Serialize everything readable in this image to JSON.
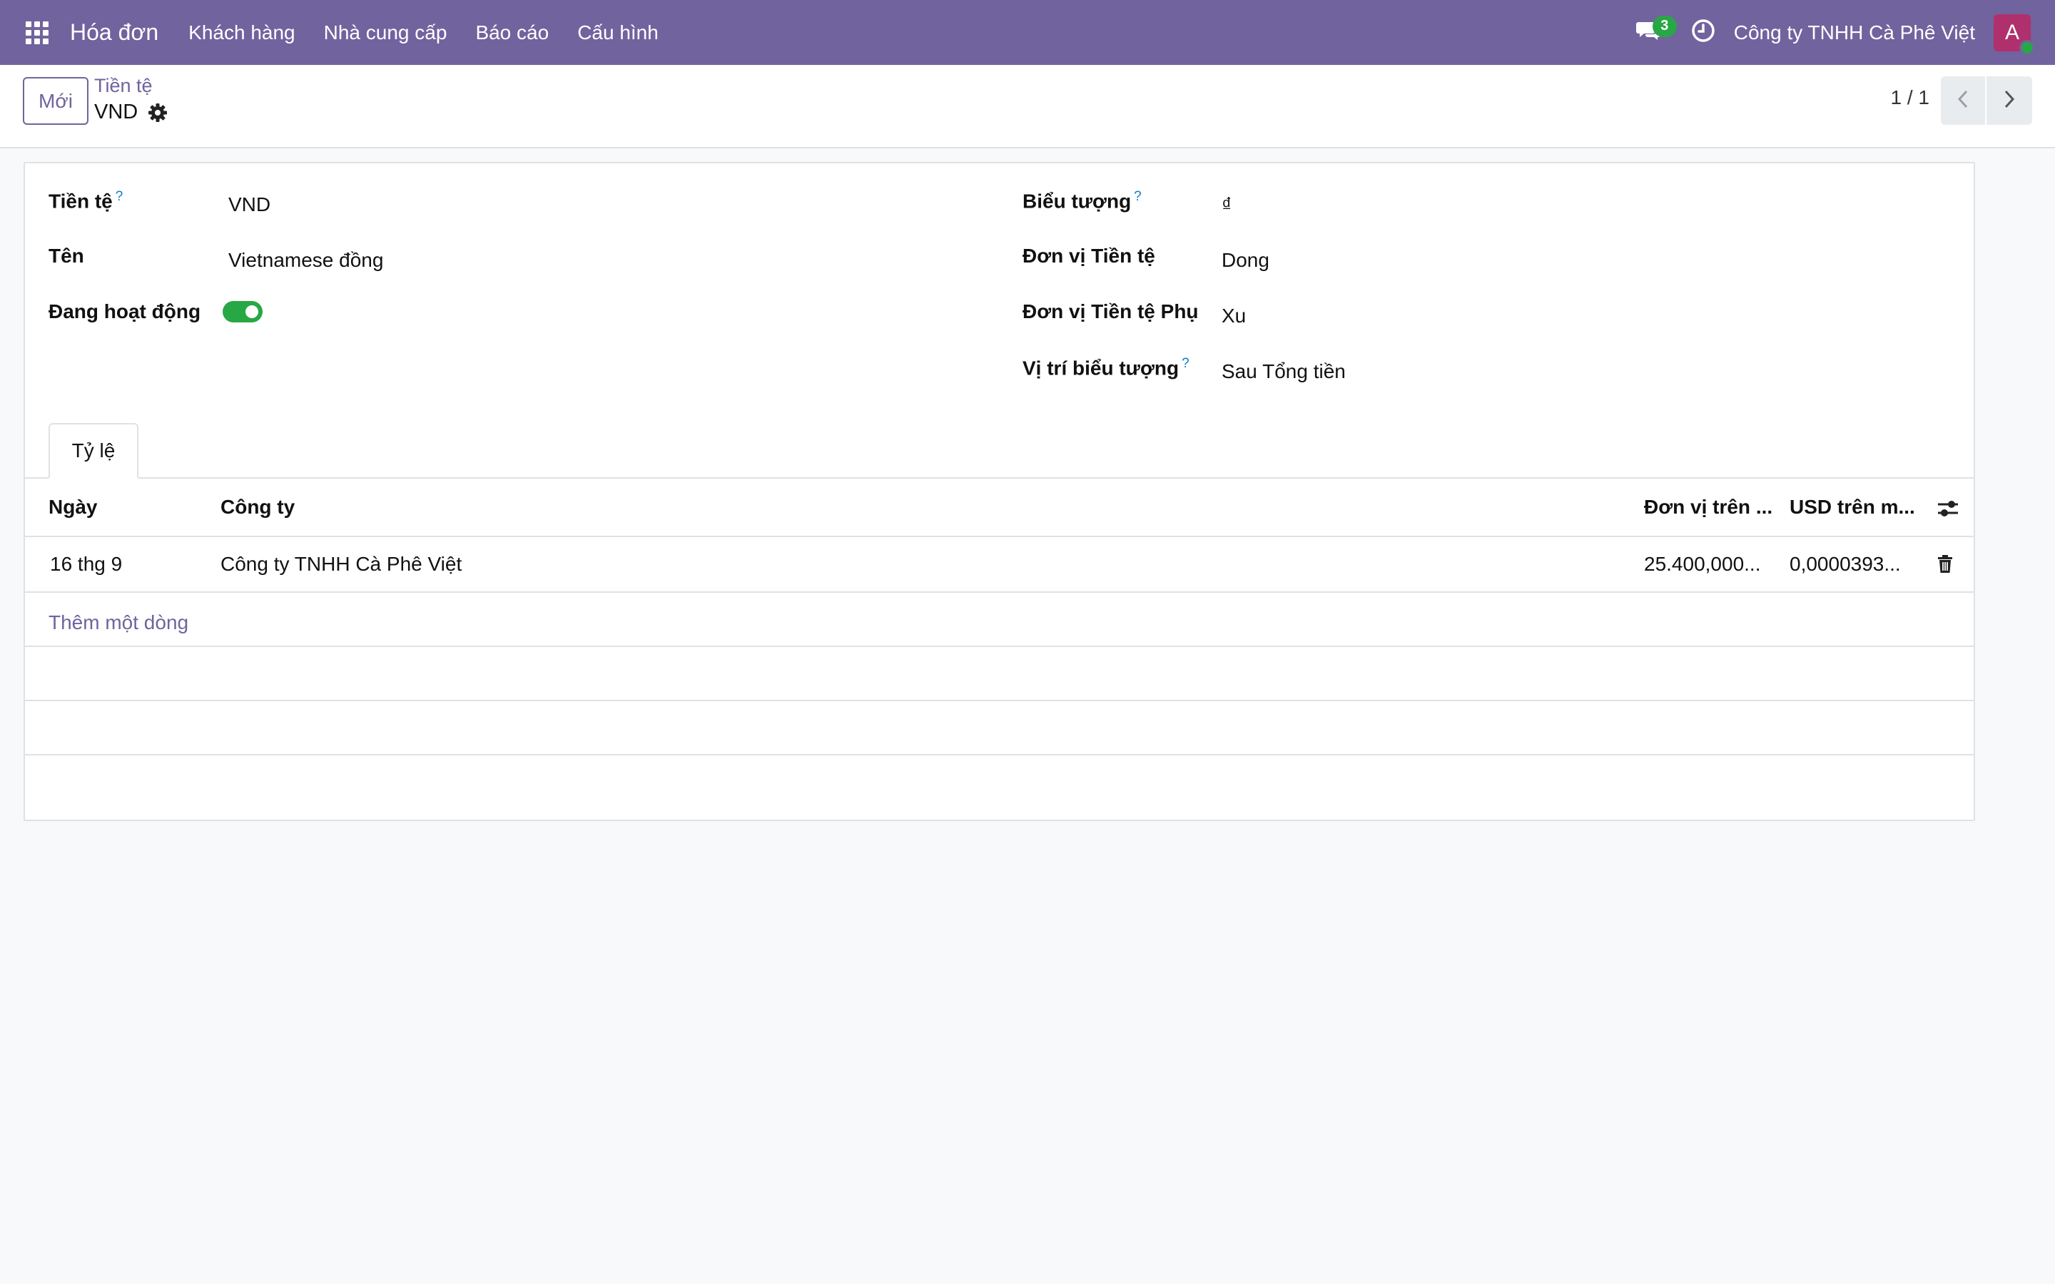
{
  "navbar": {
    "app_name": "Hóa đơn",
    "menu": [
      "Khách hàng",
      "Nhà cung cấp",
      "Báo cáo",
      "Cấu hình"
    ],
    "messages_count": "3",
    "company": "Công ty TNHH Cà Phê Việt",
    "avatar_letter": "A",
    "icons": [
      "apps-grid-icon",
      "chat-icon",
      "clock-icon"
    ],
    "colors": {
      "bar": "#71639e",
      "badge": "#28a745",
      "avatar": "#b0306d"
    }
  },
  "control_panel": {
    "new_label": "Mới",
    "breadcrumb": "Tiền tệ",
    "record_name": "VND",
    "pager": "1 / 1"
  },
  "form": {
    "left": [
      {
        "label": "Tiền tệ",
        "help": "?",
        "value": "VND"
      },
      {
        "label": "Tên",
        "value": "Vietnamese đồng"
      },
      {
        "label": "Đang hoạt động",
        "value": true
      }
    ],
    "right": [
      {
        "label": "Biểu tượng",
        "help": "?",
        "value": "₫"
      },
      {
        "label": "Đơn vị Tiền tệ",
        "value": "Dong"
      },
      {
        "label": "Đơn vị Tiền tệ Phụ",
        "value": "Xu"
      },
      {
        "label": "Vị trí biểu tượng",
        "help": "?",
        "value": "Sau Tổng tiền"
      }
    ]
  },
  "tab": {
    "label": "Tỷ lệ"
  },
  "rates_table": {
    "columns": [
      "Ngày",
      "Công ty",
      "Đơn vị trên ...",
      "USD trên m..."
    ],
    "rows": [
      [
        "16 thg 9",
        "Công ty TNHH Cà Phê Việt",
        "25.400,000...",
        "0,0000393..."
      ]
    ],
    "add_line": "Thêm một dòng"
  }
}
